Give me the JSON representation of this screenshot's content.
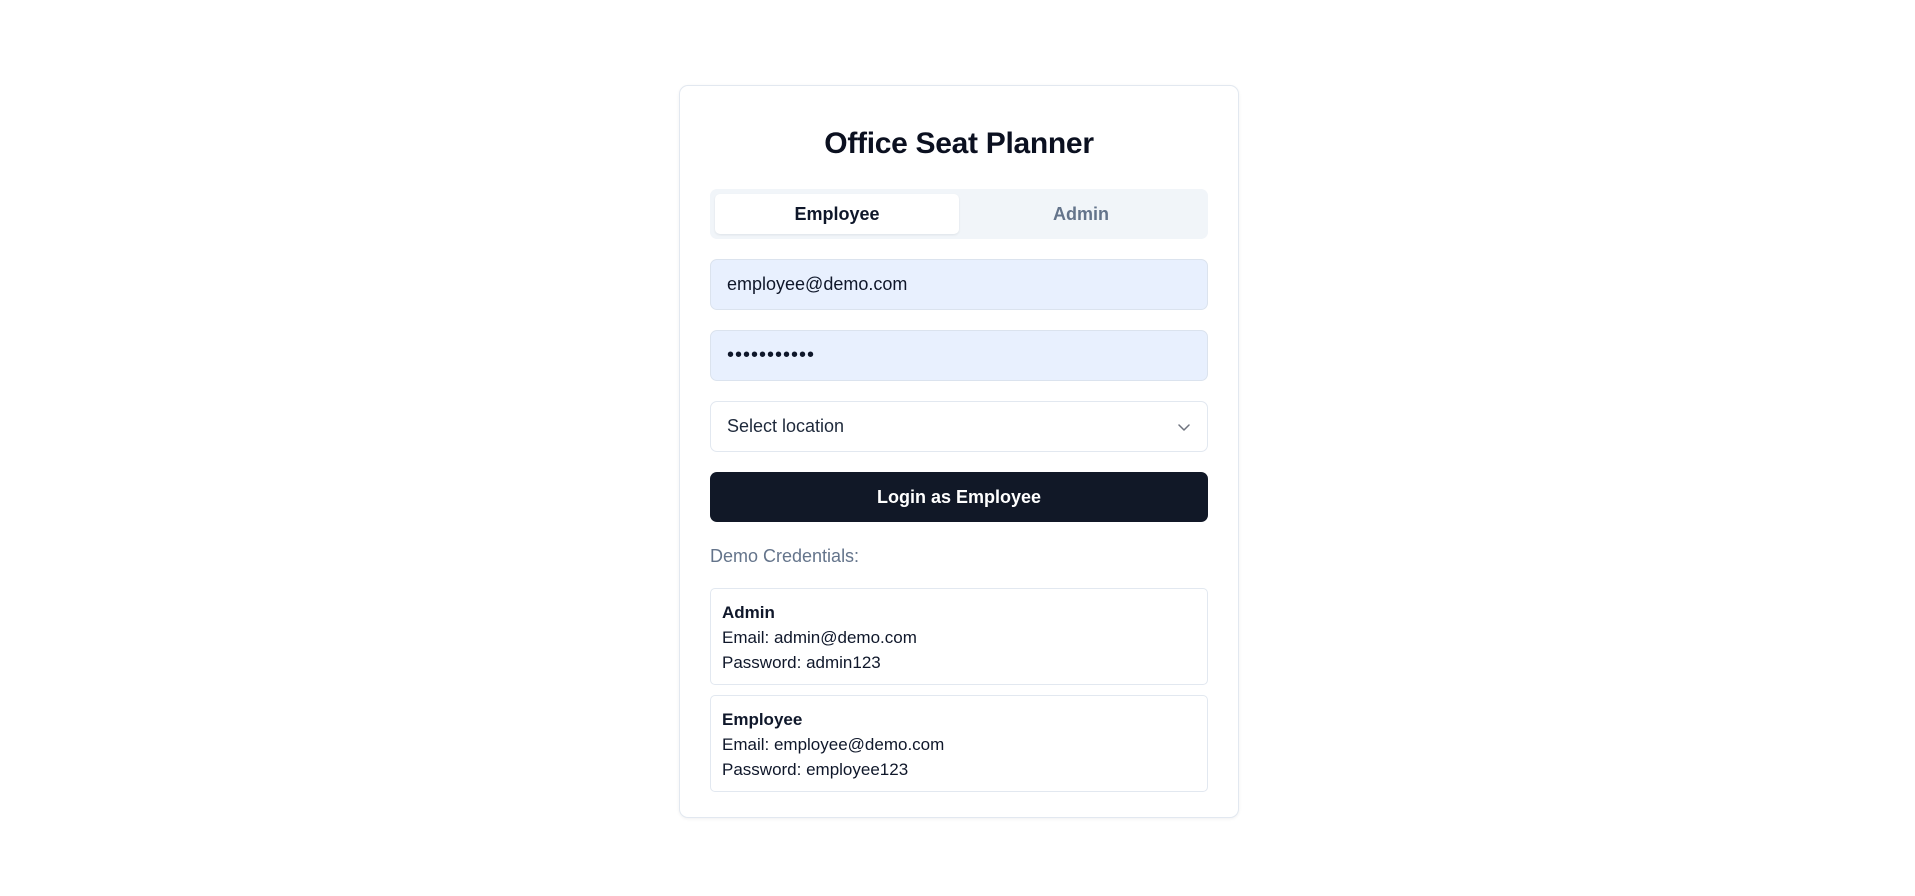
{
  "app": {
    "title": "Office Seat Planner"
  },
  "tabs": [
    {
      "label": "Employee",
      "active": true
    },
    {
      "label": "Admin",
      "active": false
    }
  ],
  "form": {
    "email_value": "employee@demo.com",
    "password_value": "employee123",
    "location_placeholder": "Select location",
    "submit_label": "Login as Employee"
  },
  "demo": {
    "heading": "Demo Credentials:",
    "accounts": [
      {
        "role": "Admin",
        "email_line": "Email: admin@demo.com",
        "password_line": "Password: admin123"
      },
      {
        "role": "Employee",
        "email_line": "Email: employee@demo.com",
        "password_line": "Password: employee123"
      }
    ]
  },
  "colors": {
    "primary_button": "#111827",
    "autofill_bg": "#e8f0fe",
    "muted_text": "#64748b",
    "tab_bg": "#f1f5f9"
  },
  "icons": {
    "select_chevron": "chevron-down-icon"
  }
}
